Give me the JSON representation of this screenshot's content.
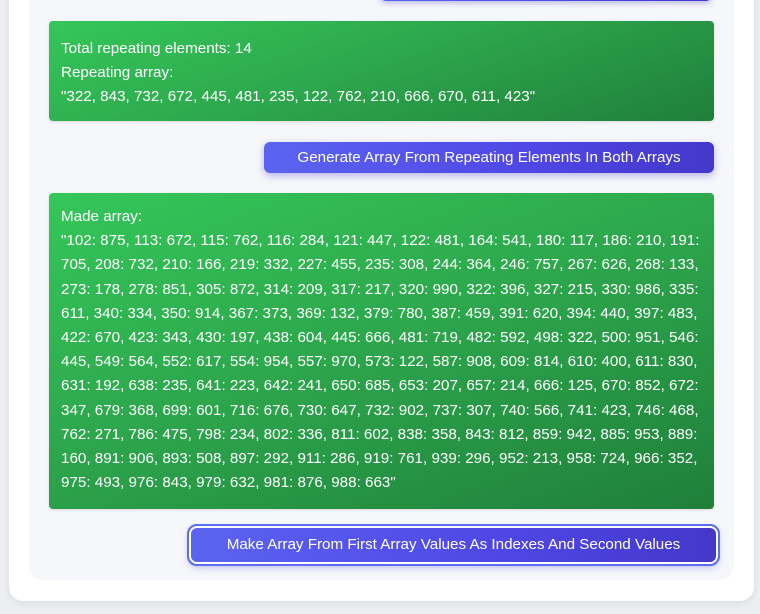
{
  "results": {
    "repeating": {
      "total_label": "Total repeating elements: 14",
      "array_label": "Repeating array:",
      "array_value": "\"322, 843, 732, 672, 445, 481, 235, 122, 762, 210, 666, 670, 611, 423\""
    },
    "made": {
      "array_label": "Made array:",
      "array_value": "\"102: 875, 113: 672, 115: 762, 116: 284, 121: 447, 122: 481, 164: 541, 180: 117, 186: 210, 191: 705, 208: 732, 210: 166, 219: 332, 227: 455, 235: 308, 244: 364, 246: 757, 267: 626, 268: 133, 273: 178, 278: 851, 305: 872, 314: 209, 317: 217, 320: 990, 322: 396, 327: 215, 330: 986, 335: 611, 340: 334, 350: 914, 367: 373, 369: 132, 379: 780, 387: 459, 391: 620, 394: 440, 397: 483, 422: 670, 423: 343, 430: 197, 438: 604, 445: 666, 481: 719, 482: 592, 498: 322, 500: 951, 546: 445, 549: 564, 552: 617, 554: 954, 557: 970, 573: 122, 587: 908, 609: 814, 610: 400, 611: 830, 631: 192, 638: 235, 641: 223, 642: 241, 650: 685, 653: 207, 657: 214, 666: 125, 670: 852, 672: 347, 679: 368, 699: 601, 716: 676, 730: 647, 732: 902, 737: 307, 740: 566, 741: 423, 746: 468, 762: 271, 786: 475, 798: 234, 802: 336, 811: 602, 838: 358, 843: 812, 859: 942, 885: 953, 889: 160, 891: 906, 893: 508, 897: 292, 911: 286, 919: 761, 939: 296, 952: 213, 958: 724, 966: 352, 975: 493, 976: 843, 979: 632, 981: 876, 988: 663\""
    }
  },
  "buttons": {
    "generate_label": "Generate Array From Repeating Elements In Both Arrays",
    "make_label": "Make Array From First Array Values As Indexes And Second Values"
  },
  "colors": {
    "result_green": "#2ea84d",
    "button_indigo": "#4f46e5"
  }
}
